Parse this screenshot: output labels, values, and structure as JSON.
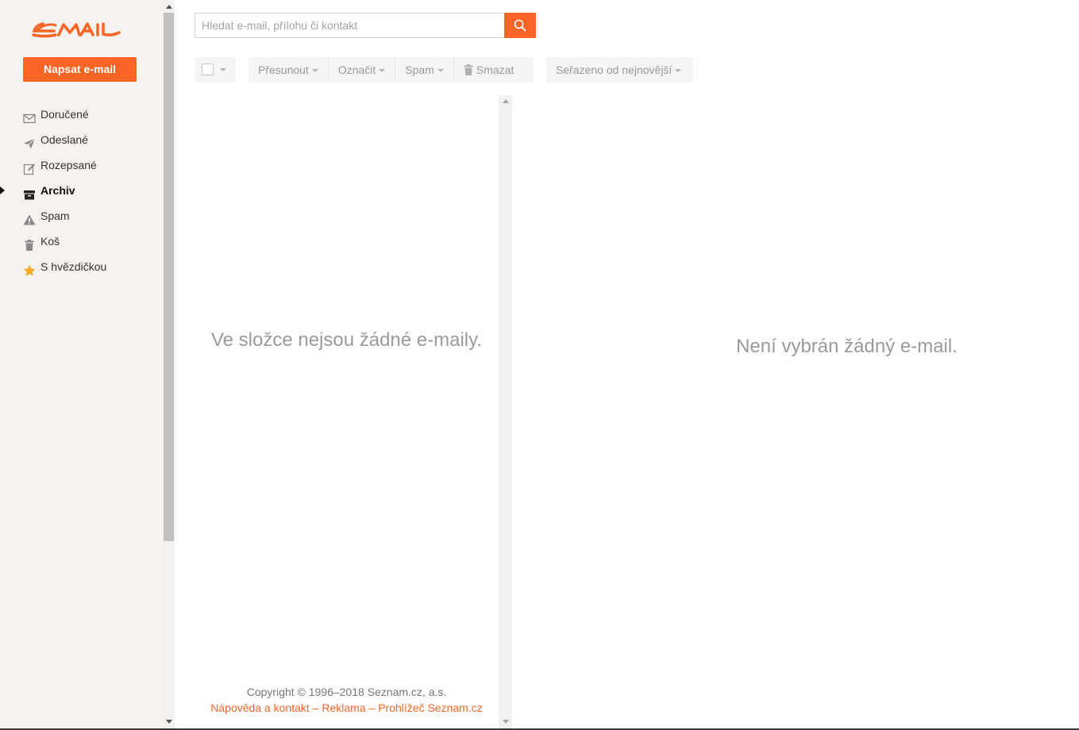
{
  "sidebar": {
    "logo": "EMAIL",
    "compose_label": "Napsat e-mail",
    "folders": [
      {
        "label": "Doručené",
        "icon": "envelope-icon"
      },
      {
        "label": "Odeslané",
        "icon": "paper-plane-icon"
      },
      {
        "label": "Rozepsané",
        "icon": "edit-icon"
      },
      {
        "label": "Archiv",
        "icon": "archive-icon",
        "active": true
      },
      {
        "label": "Spam",
        "icon": "warning-icon"
      },
      {
        "label": "Koš",
        "icon": "trash-icon"
      },
      {
        "label": "S hvězdičkou",
        "icon": "star-icon"
      }
    ]
  },
  "search": {
    "placeholder": "Hledat e-mail, přílohu či kontakt",
    "value": "",
    "icon": "search-icon"
  },
  "toolbar": {
    "move_label": "Přesunout",
    "mark_label": "Označit",
    "spam_label": "Spam",
    "delete_label": "Smazat",
    "sort_label": "Seřazeno od nejnovější"
  },
  "list": {
    "empty_text": "Ve složce nejsou žádné e-maily."
  },
  "preview": {
    "empty_text": "Není vybrán žádný e-mail."
  },
  "footer": {
    "copyright": "Copyright © 1996–2018 Seznam.cz, a.s.",
    "link_help": "Nápověda a kontakt",
    "separator": " – ",
    "link_ads": "Reklama",
    "link_browser": "Prohlížeč Seznam.cz"
  },
  "colors": {
    "accent": "#fa6525",
    "sidebar_bg": "#f6f2ef",
    "muted_text": "#9a9a9a"
  }
}
